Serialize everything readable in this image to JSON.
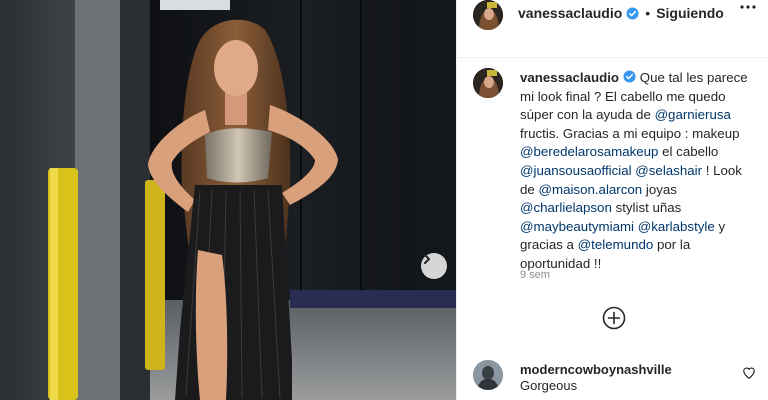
{
  "post": {
    "author": "vanessaclaudio",
    "follow_dot": "•",
    "follow_status": "Siguiendo",
    "caption": {
      "author": "vanessaclaudio",
      "text_1": "Que tal les parece mi look final ? El cabello me quedo súper con la ayuda de",
      "mention_garnier": "@garnierusa",
      "text_2": "fructis. Gracias a mi equipo : makeup",
      "mention_makeup": "@beredelarosamakeup",
      "text_3": "el cabello",
      "mention_hair1": "@juansousaofficial",
      "mention_hair2": "@selashair",
      "text_4": "! Look de",
      "mention_look": "@maison.alarcon",
      "text_5": "joyas",
      "mention_jewelry": "@charlielapson",
      "text_6": "stylist uñas",
      "mention_nails1": "@maybeautymiami",
      "mention_nails2": "@karlabstyle",
      "text_7": "y gracias a",
      "mention_network": "@telemundo",
      "text_8": "por la oportunidad !!"
    },
    "timestamp": "9 sem"
  },
  "comment": {
    "user": "moderncowboynashville",
    "text": "Gorgeous"
  },
  "icons": {
    "verified": "verified-badge-icon",
    "more": "more-options-icon",
    "load_more": "plus-circle-icon",
    "next": "chevron-right-icon",
    "like": "heart-icon"
  },
  "colors": {
    "verified_blue": "#3897f0",
    "mention_blue": "#00376b",
    "muted": "#8e8e8e",
    "text": "#262626"
  }
}
